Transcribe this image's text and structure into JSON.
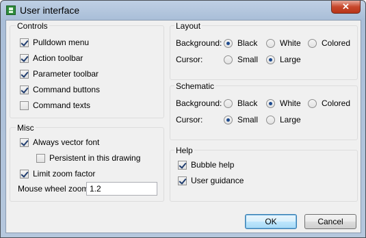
{
  "window": {
    "title": "User interface",
    "close_glyph": "✕"
  },
  "controls": {
    "title": "Controls",
    "items": [
      {
        "label": "Pulldown menu",
        "checked": true
      },
      {
        "label": "Action toolbar",
        "checked": true
      },
      {
        "label": "Parameter toolbar",
        "checked": true
      },
      {
        "label": "Command buttons",
        "checked": true
      },
      {
        "label": "Command texts",
        "checked": false
      }
    ]
  },
  "misc": {
    "title": "Misc",
    "always_vector_font": {
      "label": "Always vector font",
      "checked": true
    },
    "persistent": {
      "label": "Persistent in this drawing",
      "checked": false
    },
    "limit_zoom": {
      "label": "Limit zoom factor",
      "checked": true
    },
    "mouse_wheel_zoom": {
      "label": "Mouse wheel zoom",
      "value": "1.2"
    }
  },
  "layout": {
    "title": "Layout",
    "background_label": "Background:",
    "background_options": [
      {
        "label": "Black",
        "selected": true
      },
      {
        "label": "White",
        "selected": false
      },
      {
        "label": "Colored",
        "selected": false
      }
    ],
    "cursor_label": "Cursor:",
    "cursor_options": [
      {
        "label": "Small",
        "selected": false
      },
      {
        "label": "Large",
        "selected": true
      }
    ]
  },
  "schematic": {
    "title": "Schematic",
    "background_label": "Background:",
    "background_options": [
      {
        "label": "Black",
        "selected": false
      },
      {
        "label": "White",
        "selected": true
      },
      {
        "label": "Colored",
        "selected": false
      }
    ],
    "cursor_label": "Cursor:",
    "cursor_options": [
      {
        "label": "Small",
        "selected": true
      },
      {
        "label": "Large",
        "selected": false
      }
    ]
  },
  "help": {
    "title": "Help",
    "bubble_help": {
      "label": "Bubble help",
      "checked": true
    },
    "user_guidance": {
      "label": "User guidance",
      "checked": true
    }
  },
  "buttons": {
    "ok": "OK",
    "cancel": "Cancel"
  }
}
